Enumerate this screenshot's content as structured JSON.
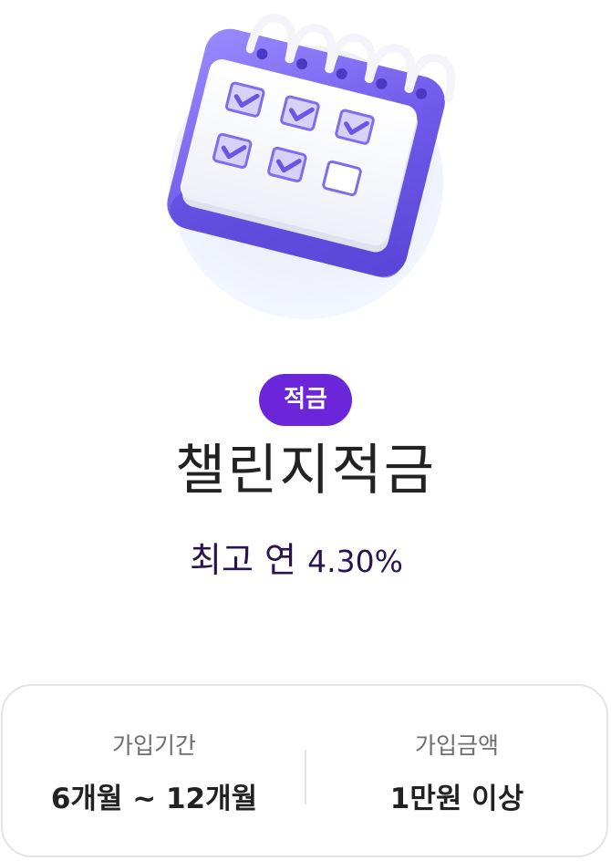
{
  "product": {
    "badge": "적금",
    "name": "챌린지적금",
    "rate_prefix": "최고 연",
    "rate_value": "4.30%"
  },
  "info": {
    "period_label": "가입기간",
    "period_value": "6개월 ~ 12개월",
    "amount_label": "가입금액",
    "amount_value": "1만원 이상"
  },
  "hero": {
    "icon": "calendar-checklist-icon"
  },
  "colors": {
    "accent": "#6b26d9",
    "calendar": "#7b67f0"
  }
}
